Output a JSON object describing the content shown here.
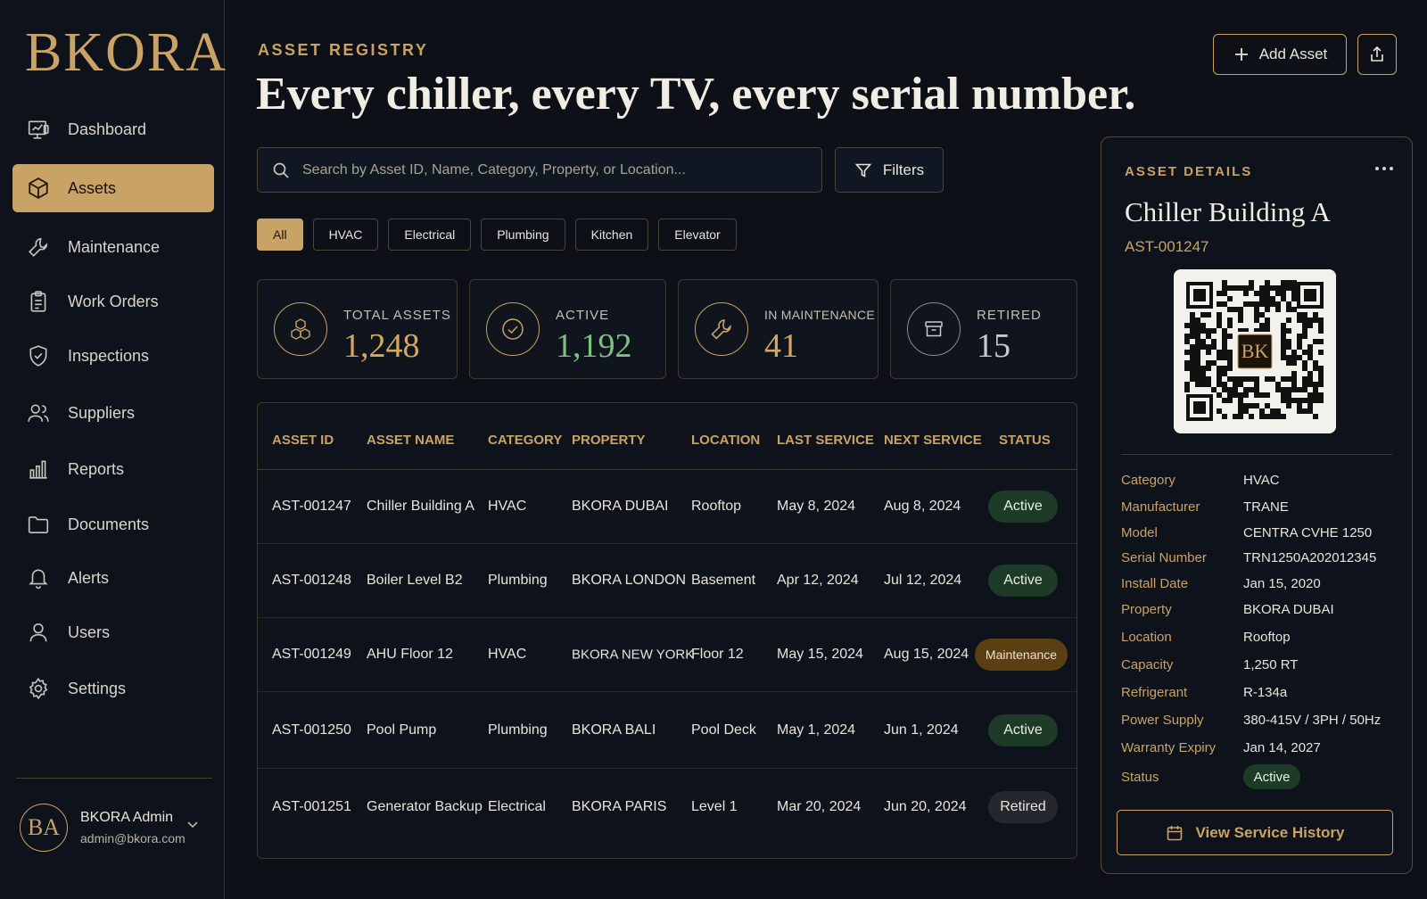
{
  "brand": {
    "logo": "BKORA"
  },
  "colors": {
    "accent": "#c9a266",
    "active_green": "#1d3b27",
    "maintenance_amber": "#5a3f12",
    "background": "#0d1117"
  },
  "sidebar": {
    "items": [
      {
        "label": "Dashboard",
        "icon": "dashboard-icon"
      },
      {
        "label": "Assets",
        "icon": "cube-icon",
        "active": true
      },
      {
        "label": "Maintenance",
        "icon": "wrench-icon"
      },
      {
        "label": "Work Orders",
        "icon": "clipboard-icon"
      },
      {
        "label": "Inspections",
        "icon": "shield-check-icon"
      },
      {
        "label": "Suppliers",
        "icon": "users-icon"
      },
      {
        "label": "Reports",
        "icon": "bar-chart-icon"
      },
      {
        "label": "Documents",
        "icon": "folder-icon"
      },
      {
        "label": "Alerts",
        "icon": "bell-icon"
      },
      {
        "label": "Users",
        "icon": "user-icon"
      },
      {
        "label": "Settings",
        "icon": "gear-icon"
      }
    ],
    "user": {
      "initials": "BA",
      "name": "BKORA Admin",
      "email": "admin@bkora.com"
    }
  },
  "header": {
    "eyebrow": "ASSET REGISTRY",
    "title": "Every chiller, every TV, every serial number.",
    "add_label": "Add Asset"
  },
  "search": {
    "placeholder": "Search by Asset ID, Name, Category, Property, or Location..."
  },
  "filters_label": "Filters",
  "chips": [
    "All",
    "HVAC",
    "Electrical",
    "Plumbing",
    "Kitchen",
    "Elevator"
  ],
  "stats": [
    {
      "label": "TOTAL ASSETS",
      "value": "1,248",
      "color": "#d4a85f",
      "icon": "cubes-icon"
    },
    {
      "label": "ACTIVE",
      "value": "1,192",
      "color": "#7fbf85",
      "icon": "check-circle-icon"
    },
    {
      "label": "IN MAINTENANCE",
      "value": "41",
      "color": "#d4a85f",
      "icon": "wrench-icon"
    },
    {
      "label": "RETIRED",
      "value": "15",
      "color": "#c7c9cf",
      "icon": "archive-icon"
    }
  ],
  "table": {
    "columns": [
      "ASSET ID",
      "ASSET NAME",
      "CATEGORY",
      "PROPERTY",
      "LOCATION",
      "LAST SERVICE",
      "NEXT SERVICE",
      "STATUS"
    ],
    "rows": [
      {
        "id": "AST-001247",
        "name": "Chiller Building A",
        "category": "HVAC",
        "property": "BKORA DUBAI",
        "location": "Rooftop",
        "last": "May 8, 2024",
        "next": "Aug 8, 2024",
        "status": "Active"
      },
      {
        "id": "AST-001248",
        "name": "Boiler Level B2",
        "category": "Plumbing",
        "property": "BKORA LONDON",
        "location": "Basement",
        "last": "Apr 12, 2024",
        "next": "Jul 12, 2024",
        "status": "Active"
      },
      {
        "id": "AST-001249",
        "name": "AHU Floor 12",
        "category": "HVAC",
        "property": "BKORA NEW YORK",
        "location": "Floor 12",
        "last": "May 15, 2024",
        "next": "Aug 15, 2024",
        "status": "Maintenance"
      },
      {
        "id": "AST-001250",
        "name": "Pool Pump",
        "category": "Plumbing",
        "property": "BKORA BALI",
        "location": "Pool Deck",
        "last": "May 1, 2024",
        "next": "Jun 1, 2024",
        "status": "Active"
      },
      {
        "id": "AST-001251",
        "name": "Generator Backup",
        "category": "Electrical",
        "property": "BKORA PARIS",
        "location": "Level 1",
        "last": "Mar 20, 2024",
        "next": "Jun 20, 2024",
        "status": "Retired"
      }
    ]
  },
  "details": {
    "eyebrow": "ASSET DETAILS",
    "title": "Chiller Building A",
    "asset_id": "AST-001247",
    "qr_monogram": "BK",
    "specs": [
      {
        "key": "Category",
        "value": "HVAC"
      },
      {
        "key": "Manufacturer",
        "value": "TRANE"
      },
      {
        "key": "Model",
        "value": "CENTRA CVHE 1250"
      },
      {
        "key": "Serial Number",
        "value": "TRN1250A202012345"
      },
      {
        "key": "Install Date",
        "value": "Jan 15, 2020"
      },
      {
        "key": "Property",
        "value": "BKORA DUBAI"
      },
      {
        "key": "Location",
        "value": "Rooftop"
      },
      {
        "key": "Capacity",
        "value": "1,250 RT"
      },
      {
        "key": "Refrigerant",
        "value": "R-134a"
      },
      {
        "key": "Power Supply",
        "value": "380-415V / 3PH / 50Hz"
      },
      {
        "key": "Warranty Expiry",
        "value": "Jan 14, 2027"
      },
      {
        "key": "Status",
        "value": "Active"
      }
    ],
    "history_label": "View Service History"
  }
}
